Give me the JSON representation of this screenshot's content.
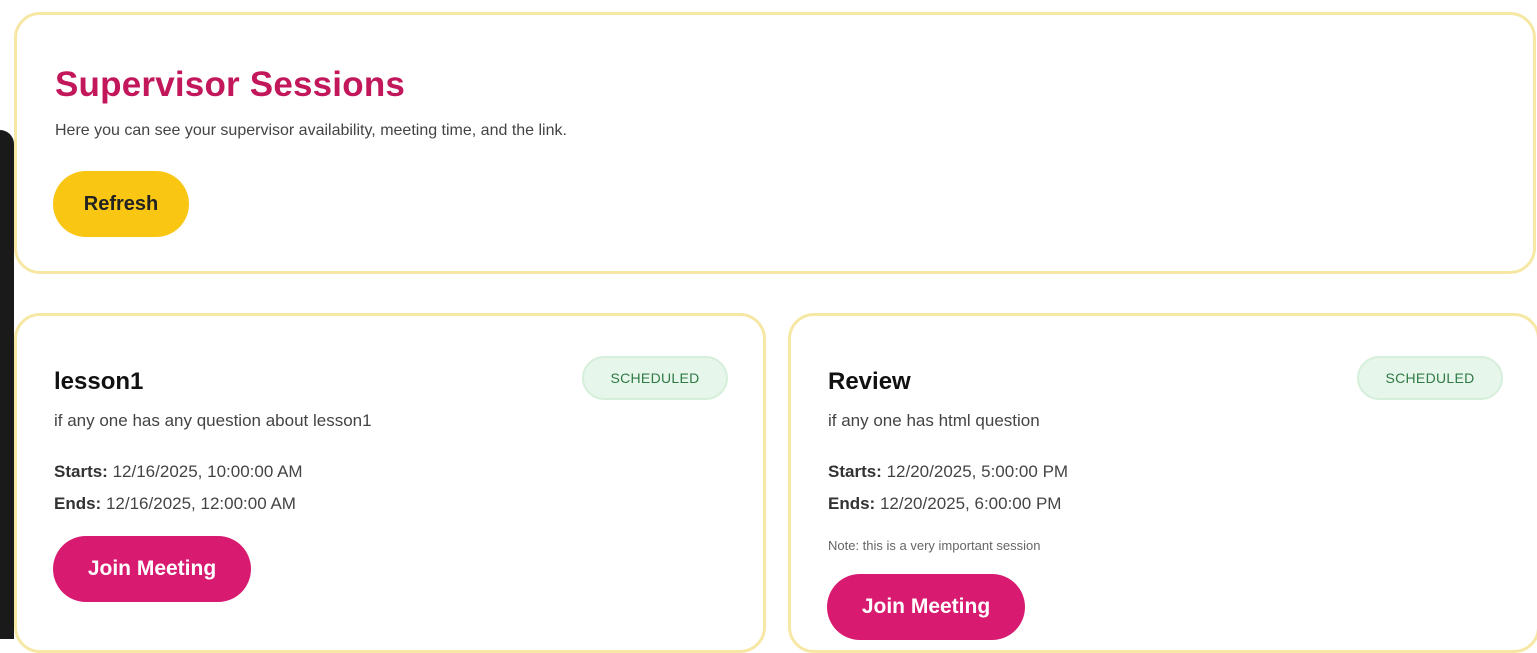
{
  "header": {
    "title": "Supervisor Sessions",
    "subtitle": "Here you can see your supervisor availability, meeting time, and the link.",
    "refresh_label": "Refresh"
  },
  "theme": {
    "title_color": "#c2185b",
    "refresh_color": "#f9c614",
    "join_color": "#d81b70",
    "card_border": "#f6e8a4",
    "badge_bg": "#e6f6ea",
    "badge_text": "#2f7a45"
  },
  "sessions": [
    {
      "title": "lesson1",
      "status": "SCHEDULED",
      "description": "if any one has any question about lesson1",
      "starts_label": "Starts:",
      "starts": "12/16/2025, 10:00:00 AM",
      "ends_label": "Ends:",
      "ends": "12/16/2025, 12:00:00 AM",
      "note": "",
      "join_label": "Join Meeting"
    },
    {
      "title": "Review",
      "status": "SCHEDULED",
      "description": "if any one has html question",
      "starts_label": "Starts:",
      "starts": "12/20/2025, 5:00:00 PM",
      "ends_label": "Ends:",
      "ends": "12/20/2025, 6:00:00 PM",
      "note": "Note: this is a very important session",
      "join_label": "Join Meeting"
    }
  ]
}
